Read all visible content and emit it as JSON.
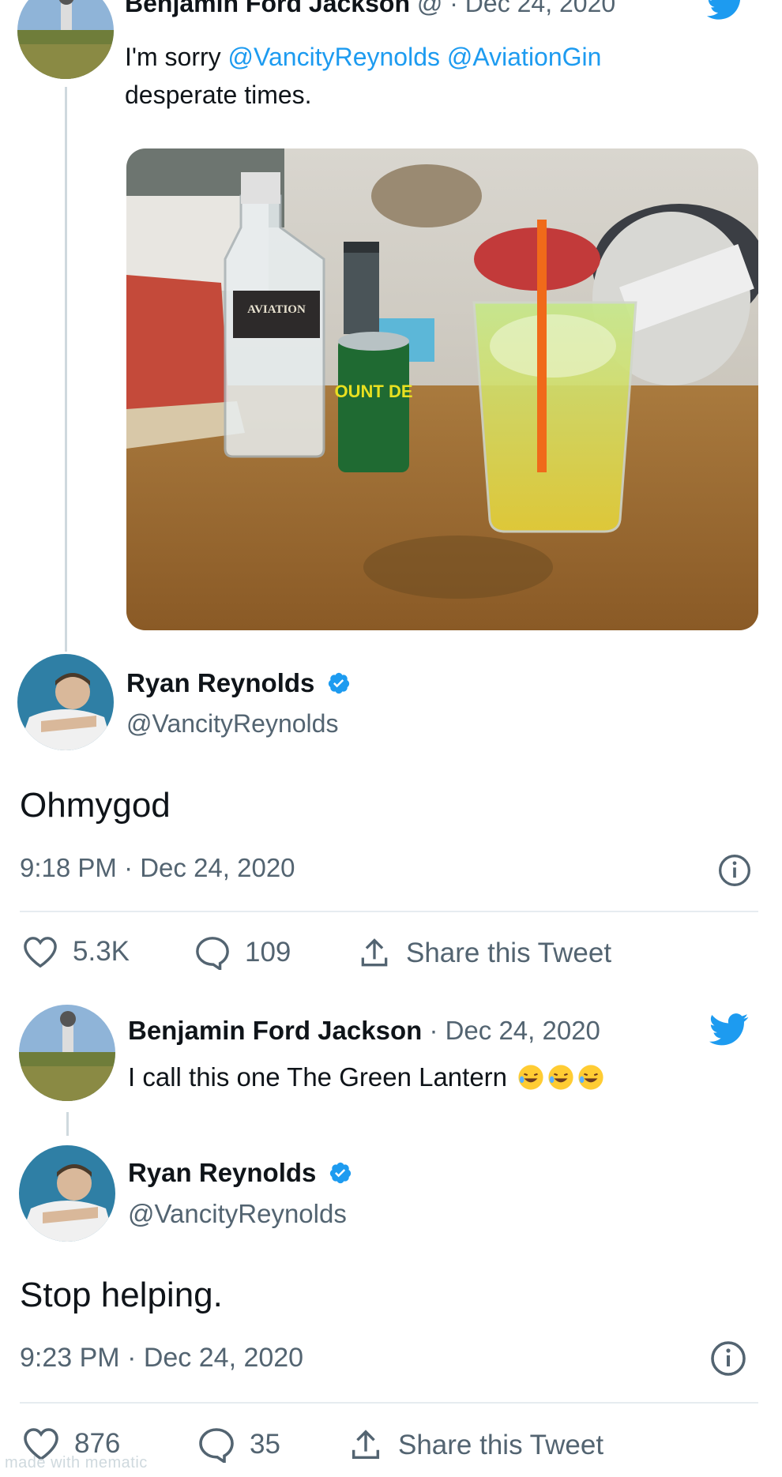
{
  "tweet1": {
    "author_name": "Benjamin Ford Jackson",
    "handle_fragment": "@",
    "date": "· Dec 24, 2020",
    "text_prefix": "I'm sorry ",
    "mention1": "@VancityReynolds",
    "mention2": "@AviationGin",
    "text_line2": "desperate times.",
    "photo_labels": {
      "bottle": "AVIATION",
      "can": "OUNT DE"
    }
  },
  "reply1": {
    "author_name": "Ryan Reynolds",
    "handle": "@VancityReynolds",
    "text": "Ohmygod",
    "timestamp": "9:18 PM · Dec 24, 2020",
    "likes": "5.3K",
    "replies": "109",
    "share": "Share this Tweet"
  },
  "tweet2": {
    "author_name": "Benjamin Ford Jackson",
    "date": "· Dec 24, 2020",
    "text": "I call this one The Green Lantern"
  },
  "reply2": {
    "author_name": "Ryan Reynolds",
    "handle": "@VancityReynolds",
    "text": "Stop helping.",
    "timestamp": "9:23 PM · Dec 24, 2020",
    "likes": "876",
    "replies": "35",
    "share": "Share this Tweet"
  },
  "watermark": "made with mematic",
  "colors": {
    "twitter_blue": "#1d9bf0",
    "muted": "#536471"
  }
}
